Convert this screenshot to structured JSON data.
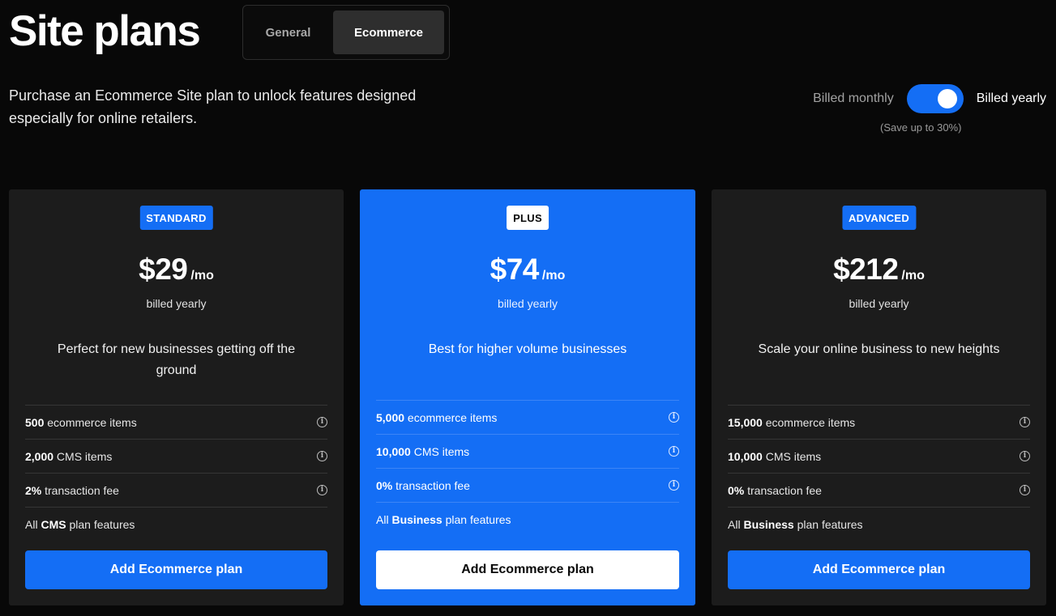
{
  "header": {
    "title": "Site plans",
    "description": "Purchase an Ecommerce Site plan to unlock features designed especially for online retailers.",
    "tabs": [
      {
        "label": "General",
        "active": false
      },
      {
        "label": "Ecommerce",
        "active": true
      }
    ]
  },
  "billing": {
    "monthly_label": "Billed monthly",
    "yearly_label": "Billed yearly",
    "yearly_selected": true,
    "save_note": "(Save up to 30%)"
  },
  "colors": {
    "background": "#080808",
    "card": "#1c1c1c",
    "accent": "#146ef5"
  },
  "plans": [
    {
      "badge": "STANDARD",
      "price": "$29",
      "period": "/mo",
      "billed": "billed yearly",
      "tagline": "Perfect for new businesses getting off the ground",
      "features": [
        {
          "strong": "500",
          "text": " ecommerce items",
          "info": true
        },
        {
          "strong": "2,000",
          "text": " CMS items",
          "info": true
        },
        {
          "strong": "2%",
          "text": " transaction fee",
          "info": true
        },
        {
          "prefix": "All ",
          "strong": "CMS",
          "text": " plan features",
          "info": false
        }
      ],
      "cta": "Add Ecommerce plan"
    },
    {
      "badge": "PLUS",
      "price": "$74",
      "period": "/mo",
      "billed": "billed yearly",
      "tagline": "Best for higher volume businesses",
      "features": [
        {
          "strong": "5,000",
          "text": " ecommerce items",
          "info": true
        },
        {
          "strong": "10,000",
          "text": " CMS items",
          "info": true
        },
        {
          "strong": "0%",
          "text": " transaction fee",
          "info": true
        },
        {
          "prefix": "All ",
          "strong": "Business",
          "text": " plan features",
          "info": false
        }
      ],
      "cta": "Add Ecommerce plan",
      "highlighted": true
    },
    {
      "badge": "ADVANCED",
      "price": "$212",
      "period": "/mo",
      "billed": "billed yearly",
      "tagline": "Scale your online business to new heights",
      "features": [
        {
          "strong": "15,000",
          "text": " ecommerce items",
          "info": true
        },
        {
          "strong": "10,000",
          "text": " CMS items",
          "info": true
        },
        {
          "strong": "0%",
          "text": " transaction fee",
          "info": true
        },
        {
          "prefix": "All ",
          "strong": "Business",
          "text": " plan features",
          "info": false
        }
      ],
      "cta": "Add Ecommerce plan"
    }
  ]
}
